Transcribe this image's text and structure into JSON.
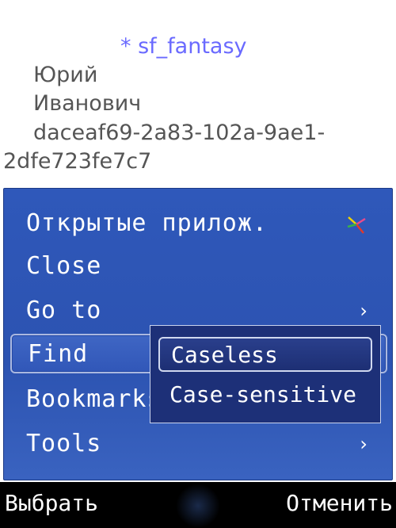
{
  "document": {
    "genre": "* sf_fantasy",
    "first_name": "Юрий",
    "middle_name": "Иванович",
    "uid_line1": "daceaf69-2a83-102a-9ae1-",
    "uid_line2": "2dfe723fe7c7"
  },
  "menu": {
    "items": [
      {
        "label": "Открытые прилож.",
        "icon": "app-switch-icon"
      },
      {
        "label": "Close"
      },
      {
        "label": "Go to",
        "arrow": "›"
      },
      {
        "label": "Find"
      },
      {
        "label": "Bookmarks"
      },
      {
        "label": "Tools",
        "arrow": "›"
      }
    ]
  },
  "submenu": {
    "items": [
      {
        "label": "Caseless"
      },
      {
        "label": "Case-sensitive"
      }
    ]
  },
  "softkeys": {
    "left": "Выбрать",
    "right": "Отменить"
  },
  "colors": {
    "menu_bg": "#2f58ba",
    "submenu_bg": "#1d3078",
    "genre_text": "#6a6aff",
    "softkey_bar": "#000000"
  }
}
